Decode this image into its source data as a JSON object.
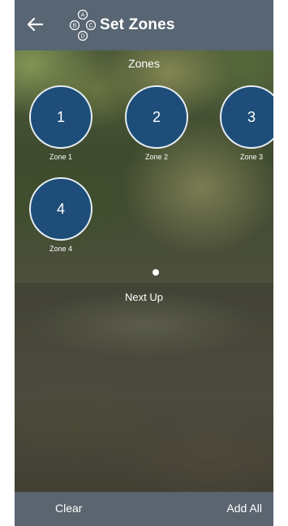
{
  "header": {
    "title": "Set Zones",
    "logo_letters": [
      "A",
      "B",
      "C",
      "D"
    ]
  },
  "zones_section": {
    "title": "Zones",
    "zones": [
      {
        "number": "1",
        "label": "Zone 1"
      },
      {
        "number": "2",
        "label": "Zone 2"
      },
      {
        "number": "3",
        "label": "Zone 3"
      },
      {
        "number": "4",
        "label": "Zone 4"
      }
    ]
  },
  "next_up": {
    "title": "Next Up"
  },
  "footer": {
    "clear_label": "Clear",
    "add_all_label": "Add All"
  },
  "colors": {
    "header_bg": "#586572",
    "zone_fill": "#1d4d78",
    "footer_bg": "#5b6570"
  }
}
